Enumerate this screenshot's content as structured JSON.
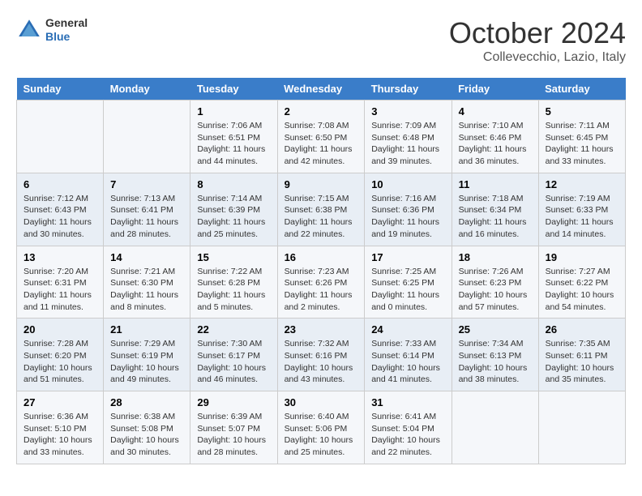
{
  "header": {
    "logo": {
      "general": "General",
      "blue": "Blue"
    },
    "title": "October 2024",
    "location": "Collevecchio, Lazio, Italy"
  },
  "days_of_week": [
    "Sunday",
    "Monday",
    "Tuesday",
    "Wednesday",
    "Thursday",
    "Friday",
    "Saturday"
  ],
  "weeks": [
    [
      {
        "num": "",
        "info": ""
      },
      {
        "num": "",
        "info": ""
      },
      {
        "num": "1",
        "info": "Sunrise: 7:06 AM\nSunset: 6:51 PM\nDaylight: 11 hours and 44 minutes."
      },
      {
        "num": "2",
        "info": "Sunrise: 7:08 AM\nSunset: 6:50 PM\nDaylight: 11 hours and 42 minutes."
      },
      {
        "num": "3",
        "info": "Sunrise: 7:09 AM\nSunset: 6:48 PM\nDaylight: 11 hours and 39 minutes."
      },
      {
        "num": "4",
        "info": "Sunrise: 7:10 AM\nSunset: 6:46 PM\nDaylight: 11 hours and 36 minutes."
      },
      {
        "num": "5",
        "info": "Sunrise: 7:11 AM\nSunset: 6:45 PM\nDaylight: 11 hours and 33 minutes."
      }
    ],
    [
      {
        "num": "6",
        "info": "Sunrise: 7:12 AM\nSunset: 6:43 PM\nDaylight: 11 hours and 30 minutes."
      },
      {
        "num": "7",
        "info": "Sunrise: 7:13 AM\nSunset: 6:41 PM\nDaylight: 11 hours and 28 minutes."
      },
      {
        "num": "8",
        "info": "Sunrise: 7:14 AM\nSunset: 6:39 PM\nDaylight: 11 hours and 25 minutes."
      },
      {
        "num": "9",
        "info": "Sunrise: 7:15 AM\nSunset: 6:38 PM\nDaylight: 11 hours and 22 minutes."
      },
      {
        "num": "10",
        "info": "Sunrise: 7:16 AM\nSunset: 6:36 PM\nDaylight: 11 hours and 19 minutes."
      },
      {
        "num": "11",
        "info": "Sunrise: 7:18 AM\nSunset: 6:34 PM\nDaylight: 11 hours and 16 minutes."
      },
      {
        "num": "12",
        "info": "Sunrise: 7:19 AM\nSunset: 6:33 PM\nDaylight: 11 hours and 14 minutes."
      }
    ],
    [
      {
        "num": "13",
        "info": "Sunrise: 7:20 AM\nSunset: 6:31 PM\nDaylight: 11 hours and 11 minutes."
      },
      {
        "num": "14",
        "info": "Sunrise: 7:21 AM\nSunset: 6:30 PM\nDaylight: 11 hours and 8 minutes."
      },
      {
        "num": "15",
        "info": "Sunrise: 7:22 AM\nSunset: 6:28 PM\nDaylight: 11 hours and 5 minutes."
      },
      {
        "num": "16",
        "info": "Sunrise: 7:23 AM\nSunset: 6:26 PM\nDaylight: 11 hours and 2 minutes."
      },
      {
        "num": "17",
        "info": "Sunrise: 7:25 AM\nSunset: 6:25 PM\nDaylight: 11 hours and 0 minutes."
      },
      {
        "num": "18",
        "info": "Sunrise: 7:26 AM\nSunset: 6:23 PM\nDaylight: 10 hours and 57 minutes."
      },
      {
        "num": "19",
        "info": "Sunrise: 7:27 AM\nSunset: 6:22 PM\nDaylight: 10 hours and 54 minutes."
      }
    ],
    [
      {
        "num": "20",
        "info": "Sunrise: 7:28 AM\nSunset: 6:20 PM\nDaylight: 10 hours and 51 minutes."
      },
      {
        "num": "21",
        "info": "Sunrise: 7:29 AM\nSunset: 6:19 PM\nDaylight: 10 hours and 49 minutes."
      },
      {
        "num": "22",
        "info": "Sunrise: 7:30 AM\nSunset: 6:17 PM\nDaylight: 10 hours and 46 minutes."
      },
      {
        "num": "23",
        "info": "Sunrise: 7:32 AM\nSunset: 6:16 PM\nDaylight: 10 hours and 43 minutes."
      },
      {
        "num": "24",
        "info": "Sunrise: 7:33 AM\nSunset: 6:14 PM\nDaylight: 10 hours and 41 minutes."
      },
      {
        "num": "25",
        "info": "Sunrise: 7:34 AM\nSunset: 6:13 PM\nDaylight: 10 hours and 38 minutes."
      },
      {
        "num": "26",
        "info": "Sunrise: 7:35 AM\nSunset: 6:11 PM\nDaylight: 10 hours and 35 minutes."
      }
    ],
    [
      {
        "num": "27",
        "info": "Sunrise: 6:36 AM\nSunset: 5:10 PM\nDaylight: 10 hours and 33 minutes."
      },
      {
        "num": "28",
        "info": "Sunrise: 6:38 AM\nSunset: 5:08 PM\nDaylight: 10 hours and 30 minutes."
      },
      {
        "num": "29",
        "info": "Sunrise: 6:39 AM\nSunset: 5:07 PM\nDaylight: 10 hours and 28 minutes."
      },
      {
        "num": "30",
        "info": "Sunrise: 6:40 AM\nSunset: 5:06 PM\nDaylight: 10 hours and 25 minutes."
      },
      {
        "num": "31",
        "info": "Sunrise: 6:41 AM\nSunset: 5:04 PM\nDaylight: 10 hours and 22 minutes."
      },
      {
        "num": "",
        "info": ""
      },
      {
        "num": "",
        "info": ""
      }
    ]
  ]
}
